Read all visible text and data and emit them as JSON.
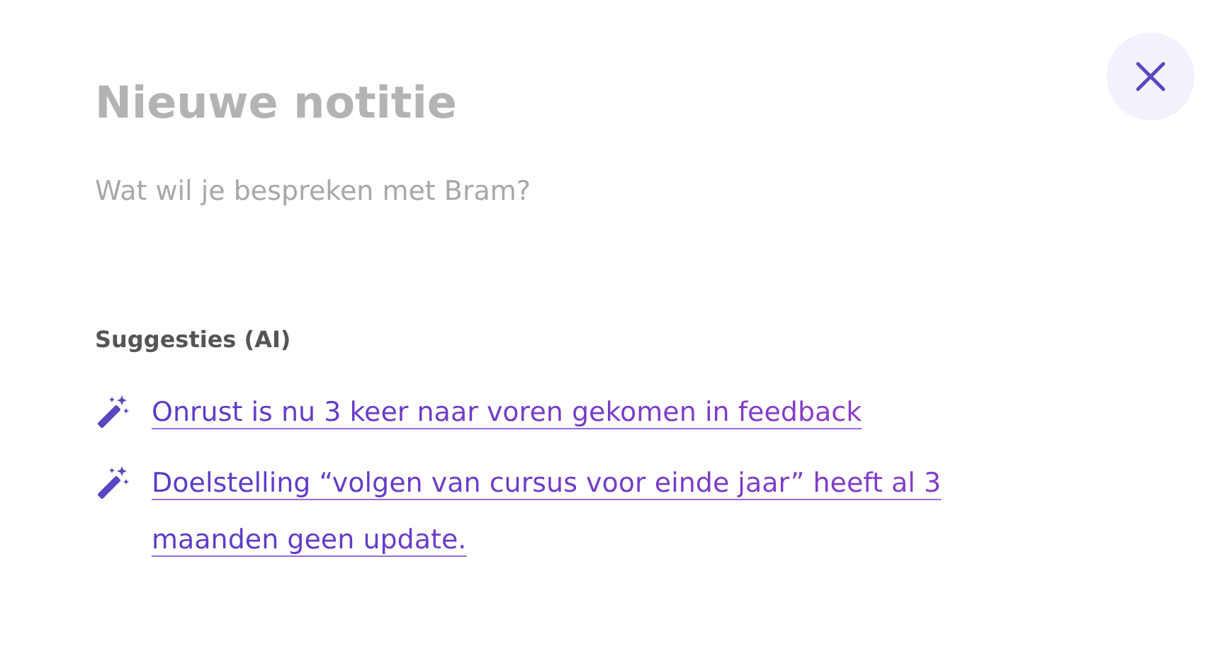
{
  "title": {
    "placeholder": "Nieuwe notitie"
  },
  "body": {
    "placeholder": "Wat wil je bespreken met Bram?"
  },
  "suggestions": {
    "heading": "Suggesties (AI)",
    "items": [
      {
        "text": "Onrust is nu 3 keer naar voren gekomen in feedback"
      },
      {
        "text": "Doelstelling “volgen van cursus voor einde jaar” heeft al 3 maanden geen update."
      }
    ]
  }
}
